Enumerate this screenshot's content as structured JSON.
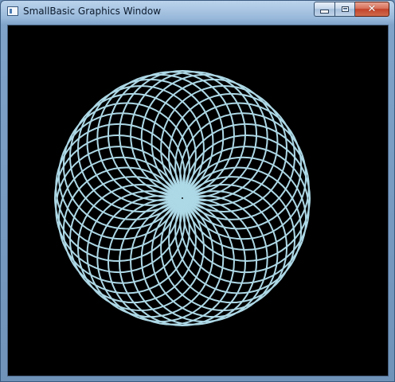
{
  "window": {
    "title": "SmallBasic Graphics Window",
    "app_icon": "window-icon",
    "buttons": {
      "minimize_icon": "minimize-icon",
      "maximize_icon": "maximize-icon",
      "close_icon": "close-icon"
    }
  },
  "canvas": {
    "background_color": "#000000",
    "pen_color": "#add8e6",
    "pattern": {
      "type": "rotated-circles",
      "circle_count": 36
    }
  }
}
